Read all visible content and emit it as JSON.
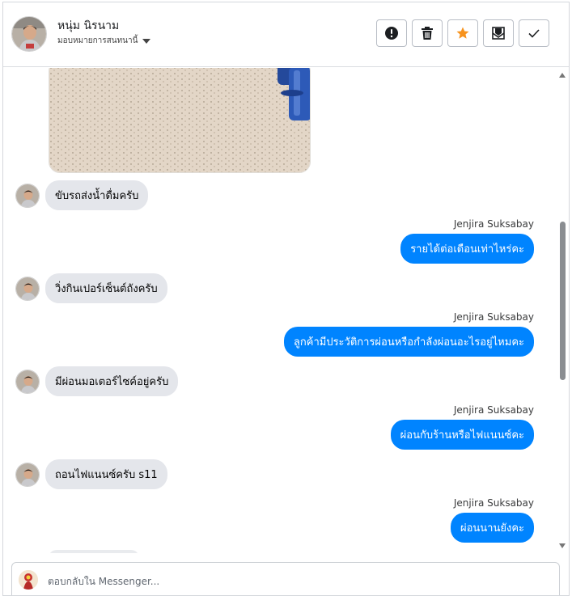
{
  "contact": {
    "name": "หนุ่ม นิรนาม",
    "assign_label": "มอบหมายการสนทนานี้"
  },
  "toolbar": [
    {
      "name": "report-button",
      "icon": "exclamation-icon"
    },
    {
      "name": "delete-button",
      "icon": "trash-icon"
    },
    {
      "name": "star-button",
      "icon": "star-icon",
      "color": "#f7931e"
    },
    {
      "name": "mark-unread-button",
      "icon": "envelope-icon"
    },
    {
      "name": "done-button",
      "icon": "checkmark-icon"
    }
  ],
  "messages": [
    {
      "dir": "in",
      "text": "ขับรถส่งน้ำดื่มครับ"
    },
    {
      "dir": "out",
      "sender": "Jenjira Suksabay",
      "text": "รายได้ต่อเดือนเท่าไหร่คะ"
    },
    {
      "dir": "in",
      "text": "วิ่งกินเปอร์เซ็นต์ถังครับ"
    },
    {
      "dir": "out",
      "sender": "Jenjira Suksabay",
      "text": "ลูกค้ามีประวัติการผ่อนหรือกำลังผ่อนอะไรอยู่ไหมคะ"
    },
    {
      "dir": "in",
      "text": "มีผ่อนมอเตอร์ไซค์อยู่ครับ"
    },
    {
      "dir": "out",
      "sender": "Jenjira Suksabay",
      "text": "ผ่อนกับร้านหรือไฟแนนซ์คะ"
    },
    {
      "dir": "in",
      "text": "ถอนไฟแนนซ์ครับ s11"
    },
    {
      "dir": "out",
      "sender": "Jenjira Suksabay",
      "text": "ผ่อนนานยังคะ"
    }
  ],
  "reply": {
    "placeholder": "ตอบกลับใน Messenger..."
  },
  "colors": {
    "outgoing_bubble": "#0084ff",
    "incoming_bubble": "#e4e6eb",
    "star": "#f7931e"
  }
}
